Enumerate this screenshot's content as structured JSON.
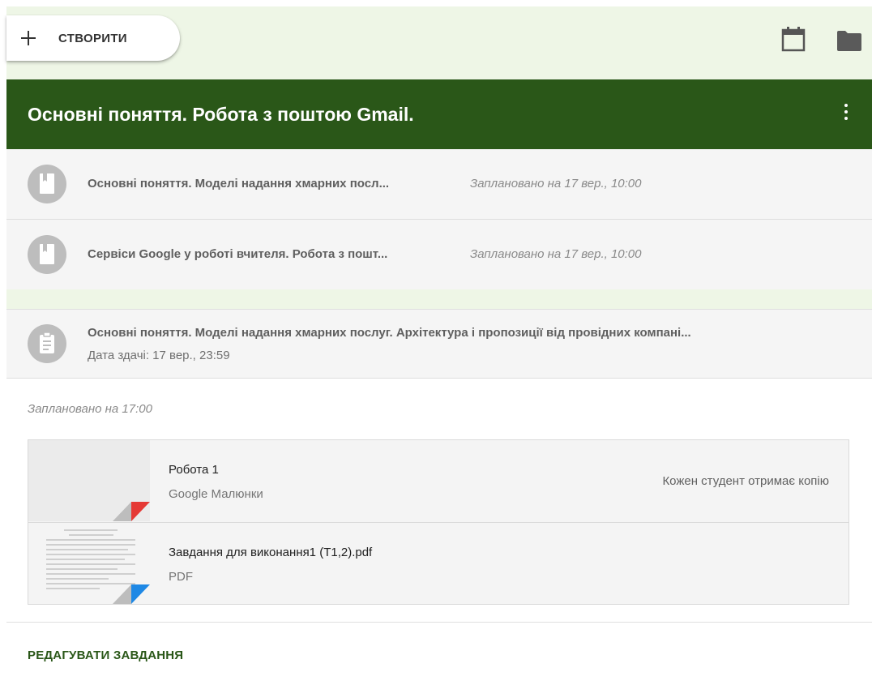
{
  "toolbar": {
    "create_label": "СТВОРИТИ"
  },
  "topic": {
    "title": "Основні поняття. Робота з поштою Gmail."
  },
  "materials": [
    {
      "title": "Основні поняття. Моделі надання хмарних посл...",
      "schedule": "Заплановано на 17 вер., 10:00",
      "icon": "bookmark-icon"
    },
    {
      "title": "Сервіси Google у роботі вчителя. Робота з пошт...",
      "schedule": "Заплановано на 17 вер., 10:00",
      "icon": "bookmark-icon"
    }
  ],
  "assignment": {
    "title": "Основні поняття. Моделі надання хмарних послуг. Архітектура і пропозиції від провідних компані...",
    "due": "Дата здачі: 17 вер., 23:59",
    "icon": "assignment-icon",
    "scheduled_at": "Заплановано на 17:00",
    "attachments": [
      {
        "name": "Робота 1",
        "type": "Google Малюнки",
        "note": "Кожен студент отримає копію",
        "corner_color": "#e53935"
      },
      {
        "name": "Завдання для виконання1 (Т1,2).pdf",
        "type": "PDF",
        "note": "",
        "corner_color": "#1e88e5"
      }
    ],
    "edit_label": "РЕДАГУВАТИ ЗАВДАННЯ"
  },
  "colors": {
    "topic_header": "#2a5718",
    "band": "#eef6e6",
    "accent": "#2a5718"
  }
}
